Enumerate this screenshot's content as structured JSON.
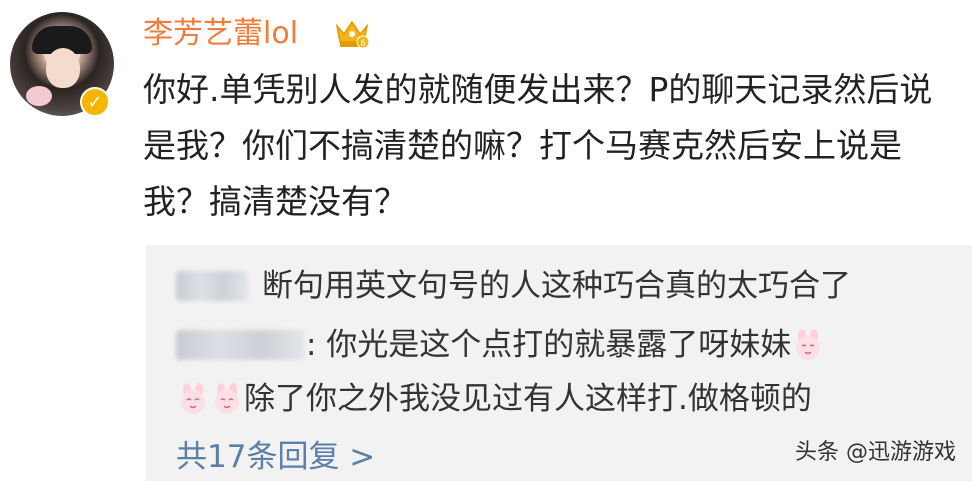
{
  "post": {
    "username": "李芳艺蕾lol",
    "text": "你好.单凭别人发的就随便发出来？P的聊天记录然后说是我？你们不搞清楚的嘛？打个马赛克然后安上说是我？搞清楚没有？"
  },
  "comments": [
    {
      "text": "断句用英文句号的人这种巧合真的太巧合了"
    },
    {
      "text": ": 你光是这个点打的就暴露了呀妹妹"
    },
    {
      "text": "除了你之外我没见过有人这样打.做格顿的"
    }
  ],
  "replies_link": "共17条回复 >",
  "watermark": "头条 @迅游游戏",
  "colors": {
    "username": "#f07b3a",
    "link": "#5b7fa8",
    "comment_bg": "#f2f2f2",
    "verified_badge": "#f7b500"
  },
  "icons": [
    "avatar",
    "verified-icon",
    "crown-icon",
    "bunny-emoji-icon"
  ]
}
